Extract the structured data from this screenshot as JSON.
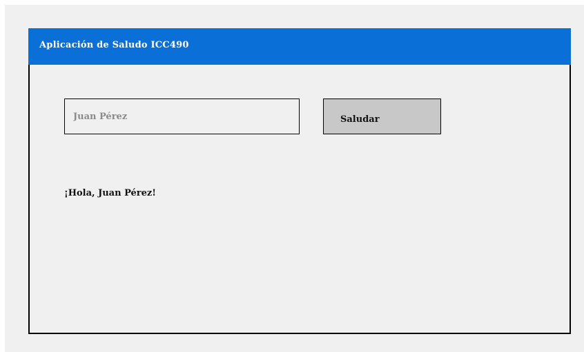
{
  "window": {
    "title": "Aplicación de Saludo ICC490"
  },
  "form": {
    "name_placeholder": "Juan Pérez",
    "name_value": "",
    "greet_button_label": "Saludar"
  },
  "output": {
    "greeting": "¡Hola, Juan Pérez!"
  },
  "colors": {
    "titlebar": "#0a6fd6",
    "background": "#f0f0f0",
    "button": "#c8c8c8",
    "border": "#000000"
  }
}
